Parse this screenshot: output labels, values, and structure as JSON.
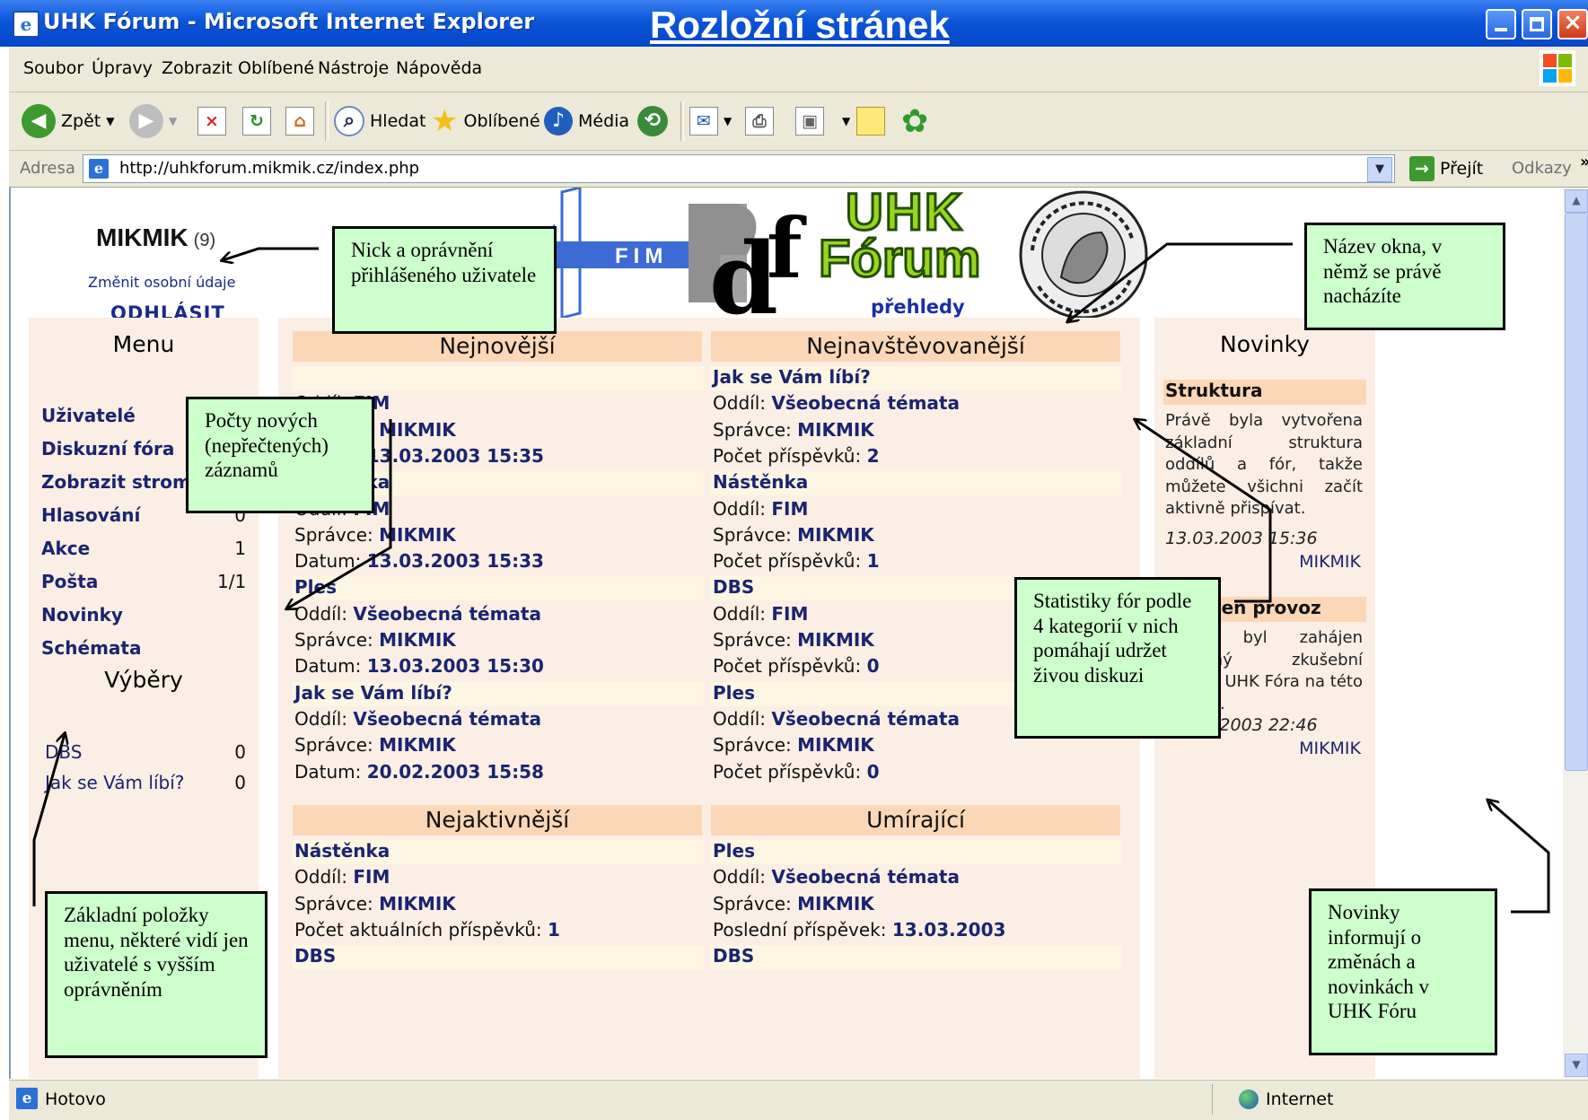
{
  "window": {
    "title": "UHK Fórum - Microsoft Internet Explorer"
  },
  "slide": {
    "title": "Rozložní stránek"
  },
  "menubar": [
    "Soubor",
    "Úpravy",
    "Zobrazit",
    "Oblíbené",
    "Nástroje",
    "Nápověda"
  ],
  "toolbar": {
    "back": "Zpět",
    "search": "Hledat",
    "favorites": "Oblíbené",
    "media": "Média"
  },
  "address": {
    "label": "Adresa",
    "url": "http://uhkforum.mikmik.cz/index.php",
    "go": "Přejít",
    "links": "Odkazy",
    "more": "»"
  },
  "user": {
    "nick": "MIKMIK",
    "rights": "(9)",
    "change": "Změnit osobní údaje",
    "logout": "ODHLÁSIT"
  },
  "header": {
    "subtitle": "přehledy",
    "fim": "FIM"
  },
  "menu": {
    "title": "Menu",
    "items": [
      {
        "label": "Uživatelé",
        "count": ""
      },
      {
        "label": "Diskuzní fóra",
        "count": ""
      },
      {
        "label": "Zobrazit strom",
        "count": ""
      },
      {
        "label": "Hlasování",
        "count": "0"
      },
      {
        "label": "Akce",
        "count": "1"
      },
      {
        "label": "Pošta",
        "count": "1/1"
      },
      {
        "label": "Novinky",
        "count": ""
      },
      {
        "label": "Schémata",
        "count": ""
      }
    ],
    "selections_title": "Výběry",
    "selections": [
      {
        "label": "DBS",
        "count": "0"
      },
      {
        "label": "Jak se Vám líbí?",
        "count": "0"
      }
    ]
  },
  "newest": {
    "title": "Nejnovější",
    "rows": [
      {
        "t": "title",
        "v": ""
      },
      {
        "l": "Oddíl: ",
        "v": "FIM"
      },
      {
        "l": "Správce: ",
        "v": "MIKMIK"
      },
      {
        "l": "Datum: ",
        "v": "13.03.2003 15:35"
      },
      {
        "t": "title",
        "v": "Nástěnka"
      },
      {
        "l": "Oddíl: ",
        "v": "FIM"
      },
      {
        "l": "Správce: ",
        "v": "MIKMIK"
      },
      {
        "l": "Datum: ",
        "v": "13.03.2003 15:33"
      },
      {
        "t": "title",
        "v": "Ples"
      },
      {
        "l": "Oddíl: ",
        "v": "Všeobecná témata"
      },
      {
        "l": "Správce: ",
        "v": "MIKMIK"
      },
      {
        "l": "Datum: ",
        "v": "13.03.2003 15:30"
      },
      {
        "t": "title",
        "v": "Jak se Vám líbí?"
      },
      {
        "l": "Oddíl: ",
        "v": "Všeobecná témata"
      },
      {
        "l": "Správce: ",
        "v": "MIKMIK"
      },
      {
        "l": "Datum: ",
        "v": "20.02.2003 15:58"
      }
    ]
  },
  "most_visited": {
    "title": "Nejnavštěvovanější",
    "rows": [
      {
        "t": "title",
        "v": "Jak se Vám líbí?"
      },
      {
        "l": "Oddíl: ",
        "v": "Všeobecná témata"
      },
      {
        "l": "Správce: ",
        "v": "MIKMIK"
      },
      {
        "l": "Počet příspěvků: ",
        "v": "2"
      },
      {
        "t": "title",
        "v": "Nástěnka"
      },
      {
        "l": "Oddíl: ",
        "v": "FIM"
      },
      {
        "l": "Správce: ",
        "v": "MIKMIK"
      },
      {
        "l": "Počet příspěvků: ",
        "v": "1"
      },
      {
        "t": "title",
        "v": "DBS"
      },
      {
        "l": "Oddíl: ",
        "v": "FIM"
      },
      {
        "l": "Správce: ",
        "v": "MIKMIK"
      },
      {
        "l": "Počet příspěvků: ",
        "v": "0"
      },
      {
        "t": "title",
        "v": "Ples"
      },
      {
        "l": "Oddíl: ",
        "v": "Všeobecná témata"
      },
      {
        "l": "Správce: ",
        "v": "MIKMIK"
      },
      {
        "l": "Počet příspěvků: ",
        "v": "0"
      }
    ]
  },
  "most_active": {
    "title": "Nejaktivnější",
    "rows": [
      {
        "t": "title",
        "v": "Nástěnka"
      },
      {
        "l": "Oddíl: ",
        "v": "FIM"
      },
      {
        "l": "Správce: ",
        "v": "MIKMIK"
      },
      {
        "l": "Počet aktuálních příspěvků: ",
        "v": "1"
      },
      {
        "t": "title",
        "v": "DBS"
      }
    ]
  },
  "dying": {
    "title": "Umírající",
    "rows": [
      {
        "t": "title",
        "v": "Ples"
      },
      {
        "l": "Oddíl: ",
        "v": "Všeobecná témata"
      },
      {
        "l": "Správce: ",
        "v": "MIKMIK"
      },
      {
        "l": "Poslední příspěvek: ",
        "v": "13.03.2003"
      },
      {
        "t": "title",
        "v": "DBS"
      }
    ]
  },
  "news": {
    "title": "Novinky",
    "items": [
      {
        "title": "Struktura",
        "text": "Právě byla vytvořena základní struktura oddílů a fór, takže můžete všichni začít aktivně přispívat.",
        "date": "13.03.2003 15:36",
        "author": "MIKMIK"
      },
      {
        "title": "Zahájen provoz",
        "text": "Právě byl zahájen dočasný zkušební provoz UHK Fóra na této adrese.",
        "date": "20.02.2003 22:46",
        "author": "MIKMIK"
      }
    ]
  },
  "callouts": {
    "nick": "Nick a oprávnění přihlášeného uživatele",
    "counts": "Počty nových (nepřečtených) záznamů",
    "window_name": "Název okna, v němž se právě nacházíte",
    "stats": "Statistiky fór podle 4 kategorií v nich pomáhají udržet živou diskuzi",
    "menu": "Základní položky menu, některé vidí jen uživatelé s vyšším oprávněním",
    "news": "Novinky informují o změnách a novinkách v UHK Fóru"
  },
  "status": {
    "text": "Hotovo",
    "zone": "Internet"
  }
}
